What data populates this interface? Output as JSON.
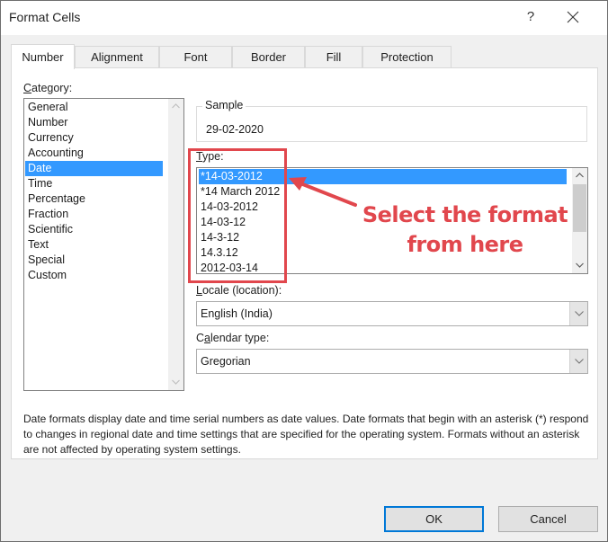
{
  "window": {
    "title": "Format Cells",
    "help_label": "?",
    "close_icon": "close-icon"
  },
  "tabs": [
    {
      "label": "Number",
      "active": true
    },
    {
      "label": "Alignment",
      "active": false
    },
    {
      "label": "Font",
      "active": false
    },
    {
      "label": "Border",
      "active": false
    },
    {
      "label": "Fill",
      "active": false
    },
    {
      "label": "Protection",
      "active": false
    }
  ],
  "category": {
    "label_accel": "C",
    "label_rest": "ategory:",
    "items": [
      "General",
      "Number",
      "Currency",
      "Accounting",
      "Date",
      "Time",
      "Percentage",
      "Fraction",
      "Scientific",
      "Text",
      "Special",
      "Custom"
    ],
    "selected": "Date"
  },
  "sample": {
    "label": "Sample",
    "value": "29-02-2020"
  },
  "type": {
    "label_accel": "T",
    "label_rest": "ype:",
    "items": [
      "*14-03-2012",
      "*14 March 2012",
      "14-03-2012",
      "14-03-12",
      "14-3-12",
      "14.3.12",
      "2012-03-14"
    ],
    "selected": "*14-03-2012"
  },
  "locale": {
    "label_accel": "L",
    "label_rest": "ocale (location):",
    "value": "English (India)"
  },
  "calendar": {
    "label_pre": "C",
    "label_accel": "a",
    "label_rest": "lendar type:",
    "value": "Gregorian"
  },
  "description": "Date formats display date and time serial numbers as date values.  Date formats that begin with an asterisk (*) respond to changes in regional date and time settings that are specified for the operating system. Formats without an asterisk are not affected by operating system settings.",
  "buttons": {
    "ok": "OK",
    "cancel": "Cancel"
  },
  "annotation": {
    "line1": "Select the format",
    "line2": "from here",
    "color": "#e1474d"
  },
  "colors": {
    "selection": "#3399ff",
    "default_button_border": "#0078d7"
  }
}
